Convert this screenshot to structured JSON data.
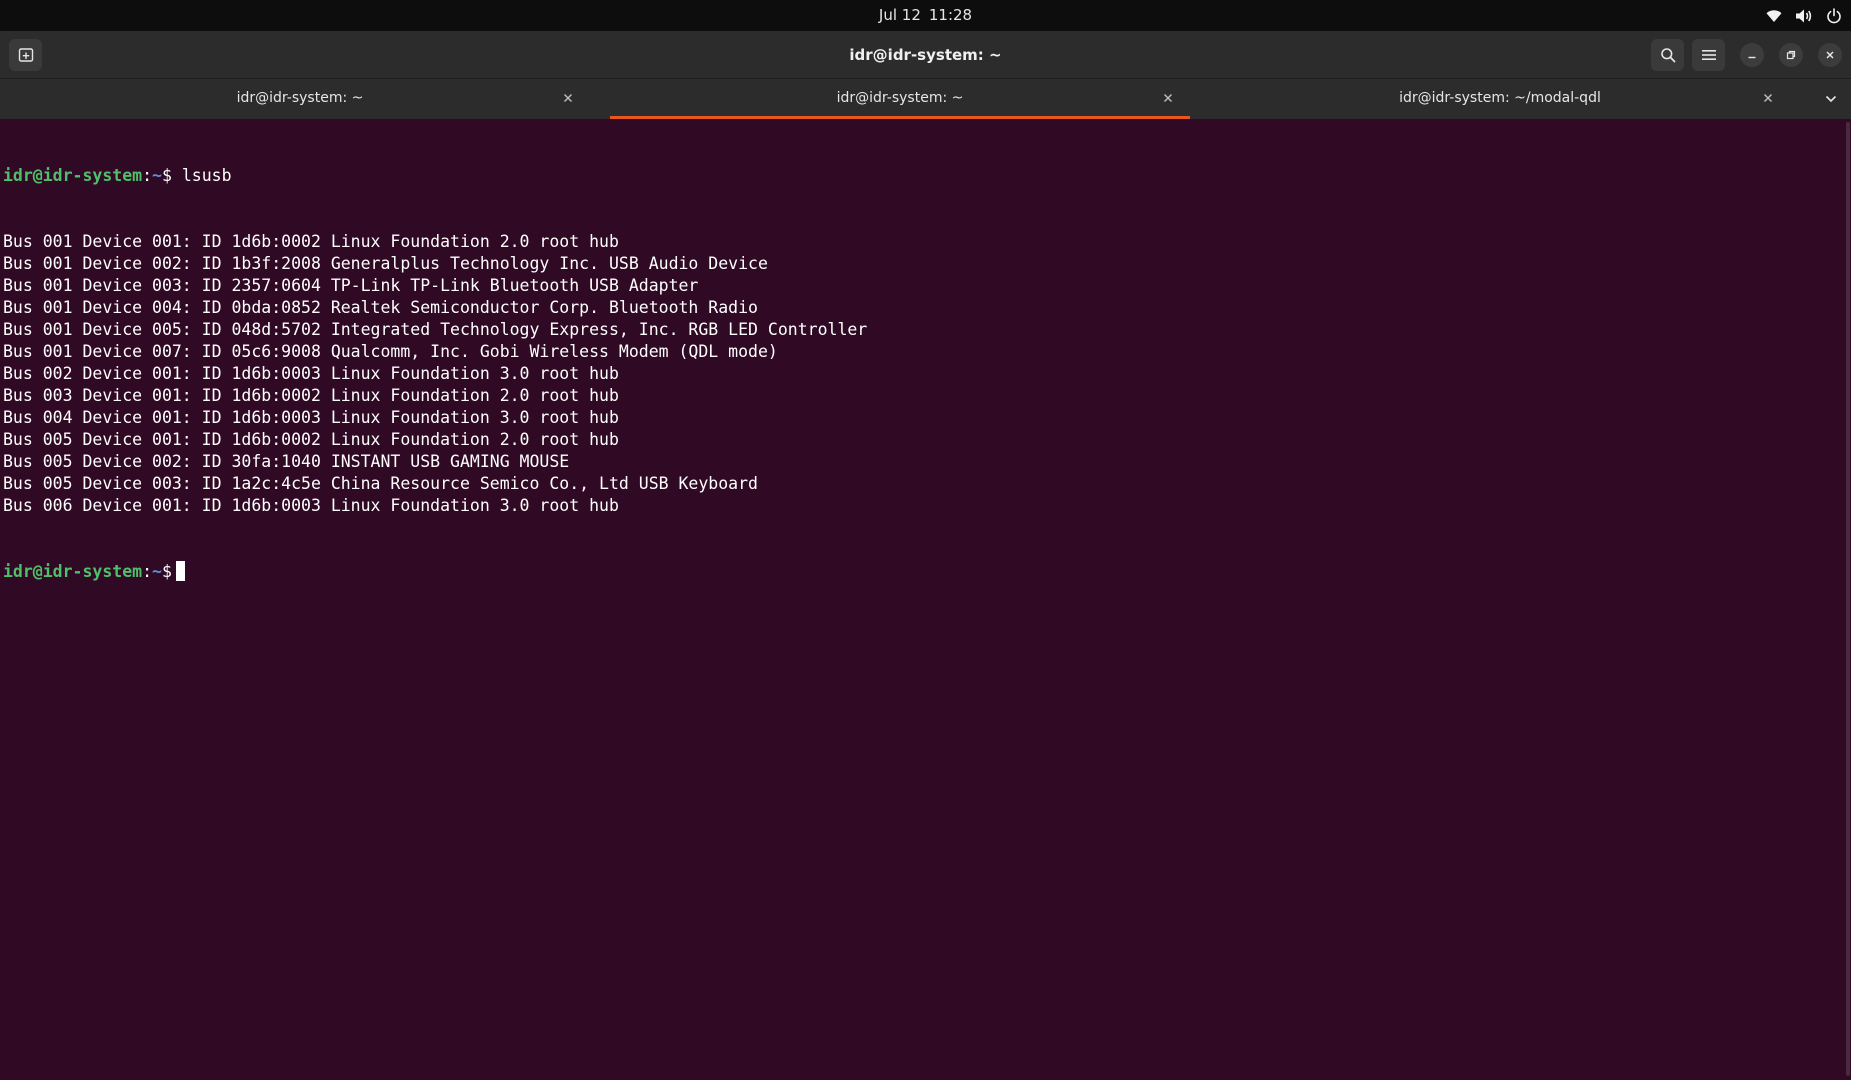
{
  "topbar": {
    "date": "Jul 12",
    "time": "11:28",
    "tray_icons": [
      "wifi-icon",
      "volume-icon",
      "power-icon"
    ]
  },
  "window": {
    "title": "idr@idr-system: ~"
  },
  "tabs": [
    {
      "label": "idr@idr-system: ~",
      "active": false
    },
    {
      "label": "idr@idr-system: ~",
      "active": true
    },
    {
      "label": "idr@idr-system: ~/modal-qdl",
      "active": false
    }
  ],
  "terminal": {
    "prompt_user": "idr@idr-system",
    "prompt_path": "~",
    "command": "lsusb",
    "output": [
      "Bus 001 Device 001: ID 1d6b:0002 Linux Foundation 2.0 root hub",
      "Bus 001 Device 002: ID 1b3f:2008 Generalplus Technology Inc. USB Audio Device",
      "Bus 001 Device 003: ID 2357:0604 TP-Link TP-Link Bluetooth USB Adapter",
      "Bus 001 Device 004: ID 0bda:0852 Realtek Semiconductor Corp. Bluetooth Radio",
      "Bus 001 Device 005: ID 048d:5702 Integrated Technology Express, Inc. RGB LED Controller",
      "Bus 001 Device 007: ID 05c6:9008 Qualcomm, Inc. Gobi Wireless Modem (QDL mode)",
      "Bus 002 Device 001: ID 1d6b:0003 Linux Foundation 3.0 root hub",
      "Bus 003 Device 001: ID 1d6b:0002 Linux Foundation 2.0 root hub",
      "Bus 004 Device 001: ID 1d6b:0003 Linux Foundation 3.0 root hub",
      "Bus 005 Device 001: ID 1d6b:0002 Linux Foundation 2.0 root hub",
      "Bus 005 Device 002: ID 30fa:1040 INSTANT USB GAMING MOUSE",
      "Bus 005 Device 003: ID 1a2c:4c5e China Resource Semico Co., Ltd USB Keyboard",
      "Bus 006 Device 001: ID 1d6b:0003 Linux Foundation 3.0 root hub"
    ]
  },
  "colors": {
    "terminal_bg": "#300a24",
    "accent": "#e95420",
    "prompt_user": "#4ec06a",
    "prompt_path": "#5b8fe0"
  }
}
